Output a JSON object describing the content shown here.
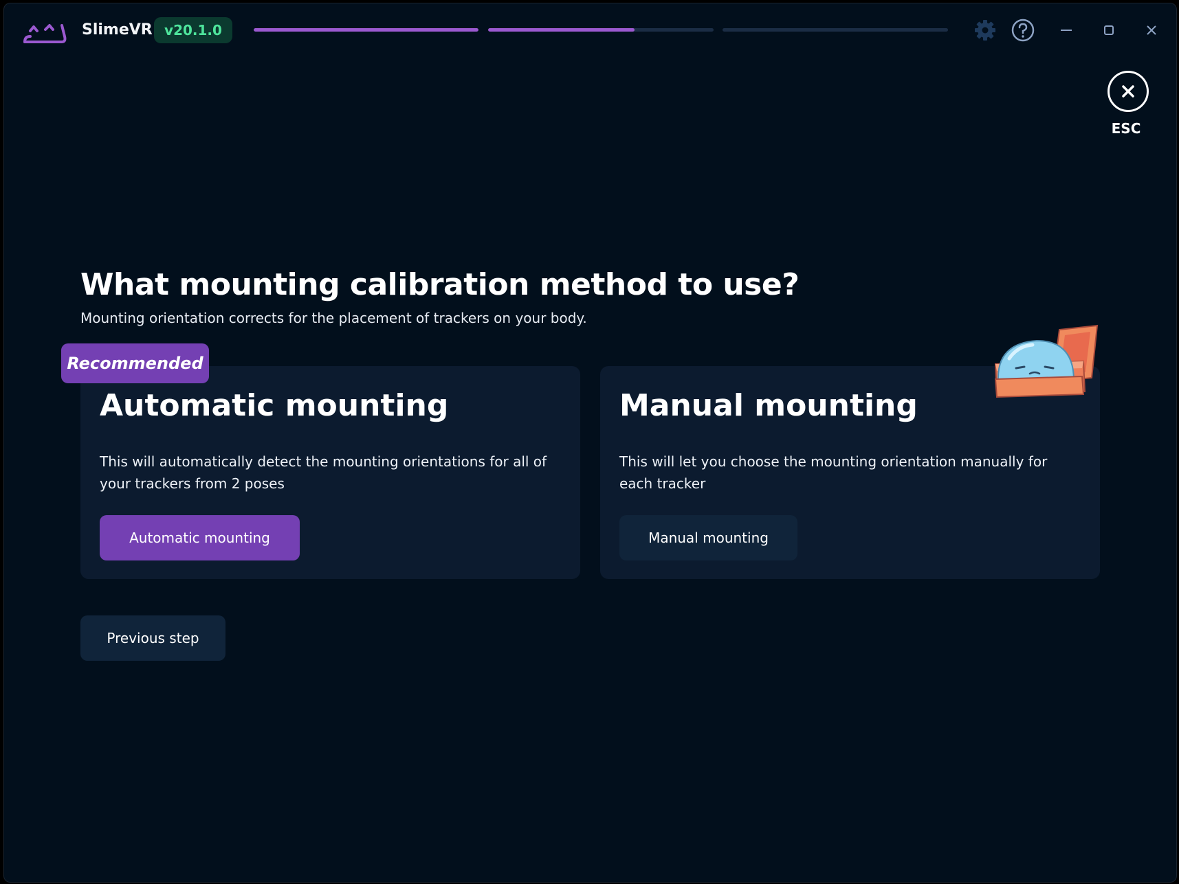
{
  "app": {
    "name": "SlimeVR",
    "version": "v20.1.0"
  },
  "wizard": {
    "steps": [
      {
        "progress": 1.0
      },
      {
        "progress": 0.65
      },
      {
        "progress": 0.0
      }
    ]
  },
  "titlebar": {
    "icons": [
      "gear-icon",
      "help-icon",
      "minimize-icon",
      "maximize-icon",
      "close-icon"
    ]
  },
  "esc": {
    "label": "ESC"
  },
  "page": {
    "title": "What mounting calibration method to use?",
    "subtitle": "Mounting orientation corrects for the placement of trackers on your body."
  },
  "automatic": {
    "badge": "Recommended",
    "title": "Automatic mounting",
    "description": "This will automatically detect the mounting orientations for all of your trackers from 2 poses",
    "button": "Automatic mounting"
  },
  "manual": {
    "title": "Manual mounting",
    "description": "This will let you choose the mounting orientation manually for each tracker",
    "button": "Manual mounting"
  },
  "navigation": {
    "previous": "Previous step"
  },
  "colors": {
    "background": "#020f1c",
    "card": "#0c1b2f",
    "accent": "#7440b3",
    "progress": "#9b59d0",
    "version_badge_bg": "#0b3a2f",
    "version_badge_text": "#4ee59c"
  }
}
